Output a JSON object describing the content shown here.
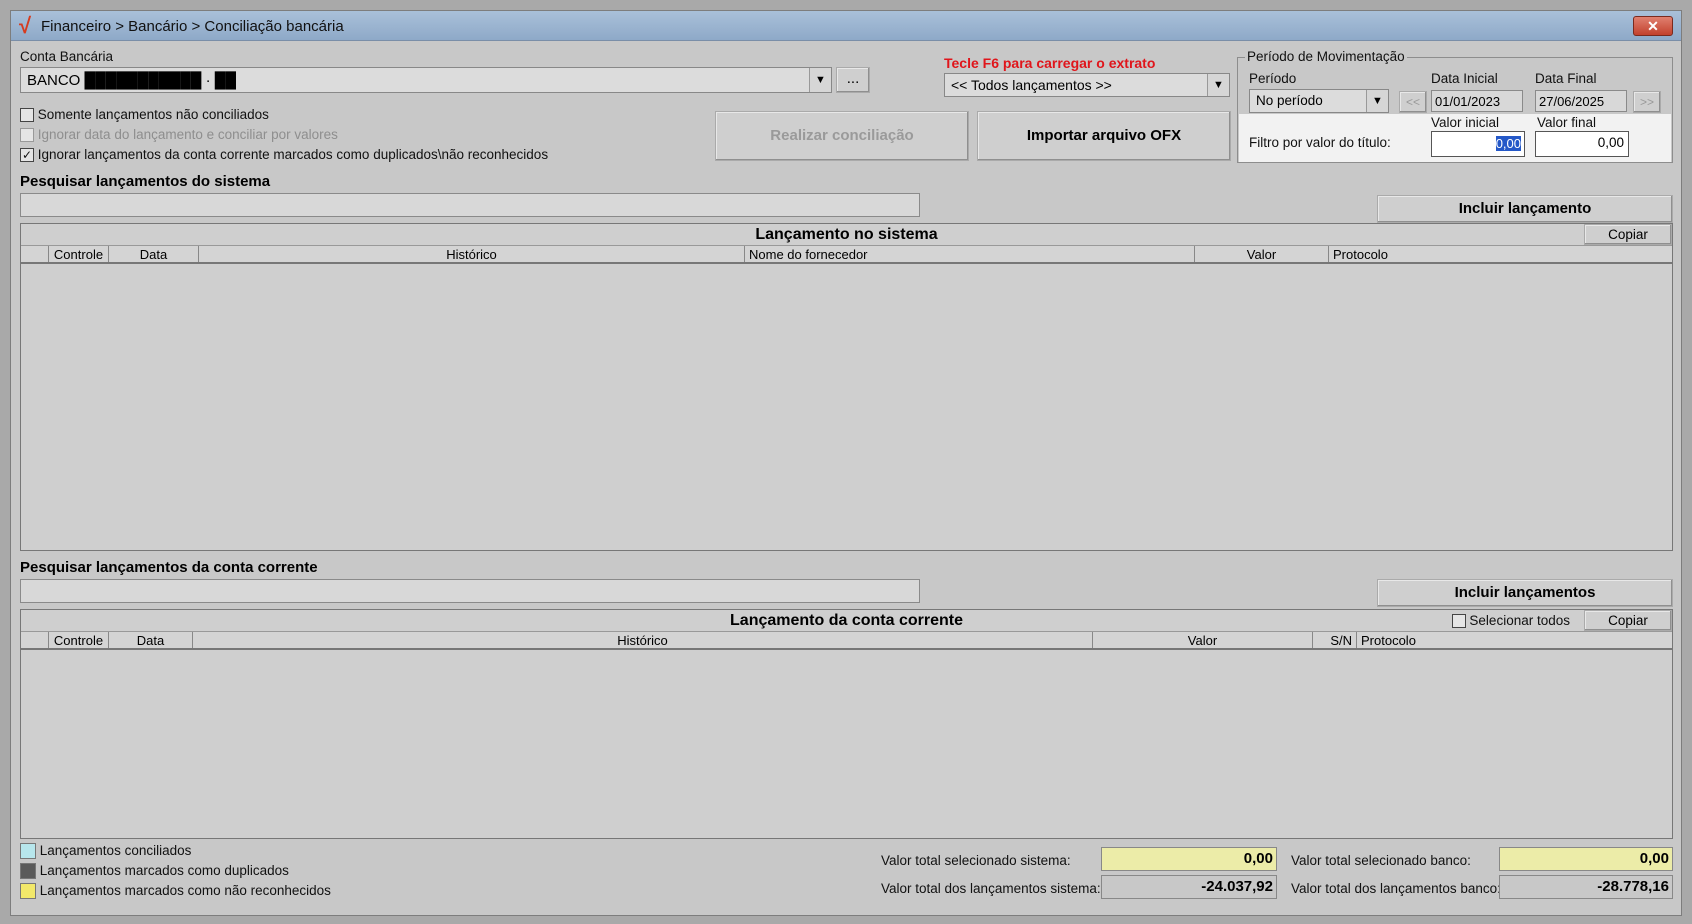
{
  "titlebar": {
    "logo": "√",
    "title": "Financeiro > Bancário > Conciliação bancária",
    "close": "✕"
  },
  "account": {
    "label": "Conta Bancária",
    "value": "BANCO ███████████ · ██",
    "browse": "..."
  },
  "f6_hint": "Tecle F6 para carregar o extrato",
  "entries_filter": {
    "value": "<< Todos lançamentos >>"
  },
  "period": {
    "group_label": "Período de Movimentação",
    "periodo_label": "Período",
    "periodo_value": "No período",
    "start_label": "Data Inicial",
    "start_value": "01/01/2023",
    "end_label": "Data Final",
    "end_value": "27/06/2025",
    "prev": "<<",
    "next": ">>",
    "valor_inicial_label": "Valor inicial",
    "valor_final_label": "Valor final",
    "filtro_label": "Filtro por valor do título:",
    "valor_inicial_value": "0,00",
    "valor_final_value": "0,00"
  },
  "options": {
    "only_unreconciled": "Somente lançamentos não conciliados",
    "ignore_date": "Ignorar data do lançamento e conciliar por valores",
    "ignore_marked": "Ignorar lançamentos da conta corrente marcados como duplicados\\não reconhecidos",
    "checkmark": "✓"
  },
  "buttons": {
    "reconcile": "Realizar conciliação",
    "import_ofx": "Importar arquivo OFX",
    "include_entry": "Incluir lançamento",
    "include_entries": "Incluir lançamentos",
    "copy": "Copiar"
  },
  "system": {
    "search_label": "Pesquisar lançamentos do sistema",
    "grid_title": "Lançamento no sistema",
    "columns": [
      "Controle",
      "Data",
      "Histórico",
      "Nome do fornecedor",
      "Valor",
      "Protocolo"
    ]
  },
  "bank": {
    "search_label": "Pesquisar lançamentos da conta corrente",
    "grid_title": "Lançamento da conta corrente",
    "select_all": "Selecionar todos",
    "columns": [
      "Controle",
      "Data",
      "Histórico",
      "Valor",
      "S/N",
      "Protocolo"
    ]
  },
  "legend": [
    {
      "label": "Lançamentos conciliados",
      "color": "#b7e6ec"
    },
    {
      "label": "Lançamentos marcados como duplicados",
      "color": "#5a5a5a"
    },
    {
      "label": "Lançamentos marcados como não reconhecidos",
      "color": "#f2e86a"
    }
  ],
  "totals": {
    "sel_system_label": "Valor total selecionado sistema:",
    "sel_system_value": "0,00",
    "all_system_label": "Valor total dos lançamentos sistema:",
    "all_system_value": "-24.037,92",
    "sel_bank_label": "Valor total selecionado banco:",
    "sel_bank_value": "0,00",
    "all_bank_label": "Valor total dos lançamentos banco:",
    "all_bank_value": "-28.778,16",
    "highlight_color": "#ececa8"
  }
}
